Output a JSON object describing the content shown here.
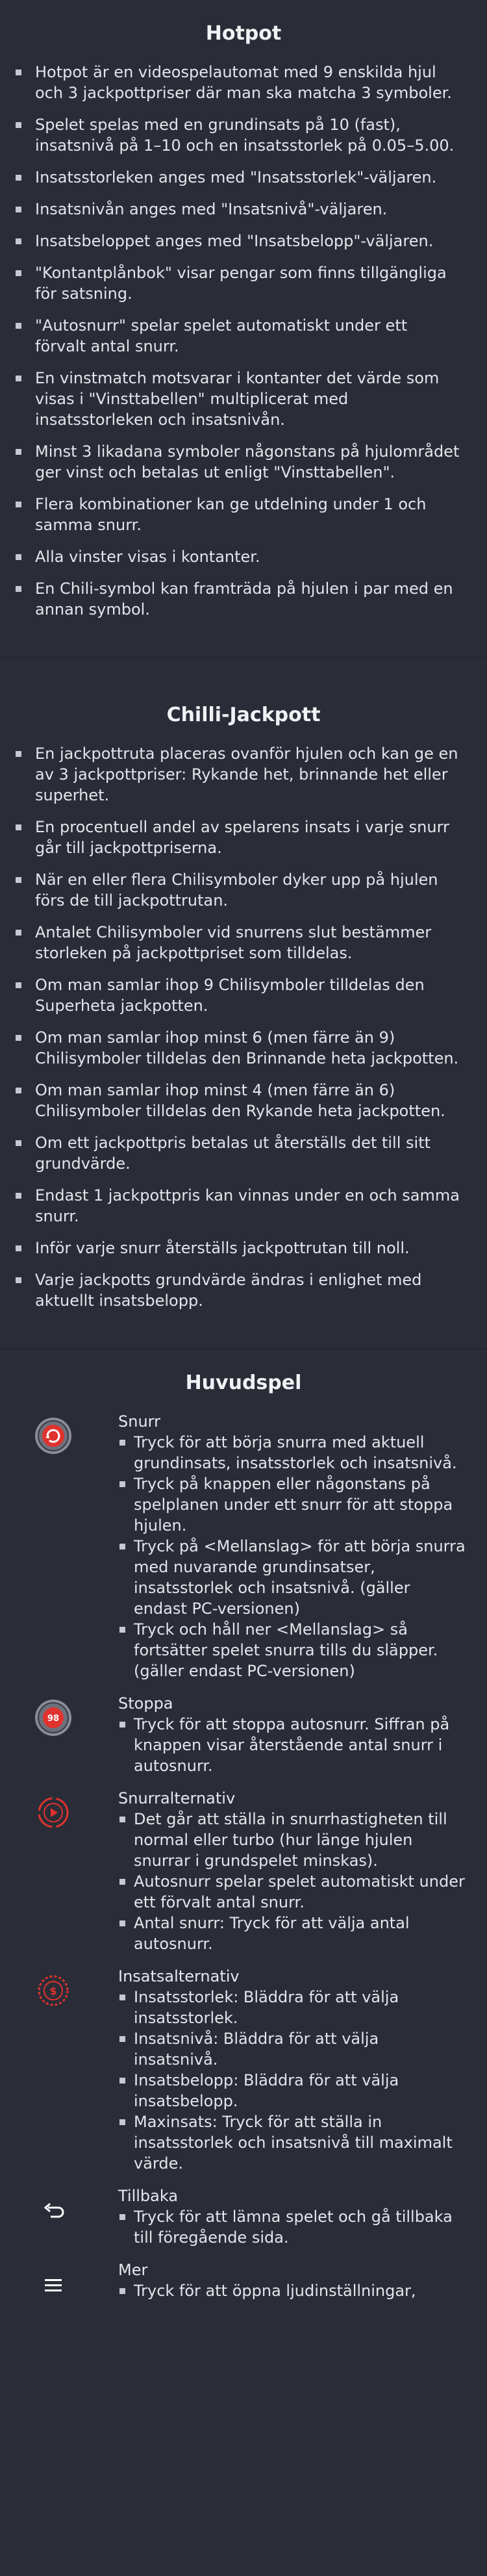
{
  "hotpot": {
    "title": "Hotpot",
    "items": [
      "Hotpot är en videospelautomat med 9 enskilda hjul och 3 jackpottpriser där man ska matcha 3 symboler.",
      "Spelet spelas med en grundinsats på 10 (fast), insatsnivå på 1–10 och en insatsstorlek på 0.05–5.00.",
      "Insatsstorleken anges med \"Insatsstorlek\"-väljaren.",
      "Insatsnivån anges med \"Insatsnivå\"-väljaren.",
      "Insatsbeloppet anges med \"Insatsbelopp\"-väljaren.",
      "\"Kontantplånbok\" visar pengar som finns tillgängliga för satsning.",
      "\"Autosnurr\" spelar spelet automatiskt under ett förvalt antal snurr.",
      "En vinstmatch motsvarar i kontanter det värde som visas i \"Vinsttabellen\" multiplicerat med insatsstorleken och insatsnivån.",
      "Minst 3  likadana symboler någonstans på hjulområdet ger vinst och betalas ut enligt \"Vinsttabellen\".",
      "Flera kombinationer kan ge utdelning under 1 och samma snurr.",
      "Alla vinster visas i kontanter.",
      "En Chili-symbol kan framträda på hjulen i par med en annan symbol."
    ]
  },
  "chilli": {
    "title": "Chilli-Jackpott",
    "items": [
      "En jackpottruta placeras ovanför hjulen och kan ge en av 3 jackpottpriser: Rykande het, brinnande het eller superhet.",
      "En procentuell andel av spelarens insats i varje snurr går till jackpottpriserna.",
      "När en eller flera Chilisymboler dyker upp på hjulen förs de till jackpottrutan.",
      "Antalet Chilisymboler vid snurrens slut bestämmer storleken på jackpottpriset som tilldelas.",
      "Om man samlar ihop 9 Chilisymboler tilldelas den Superheta jackpotten.",
      "Om man samlar ihop minst 6 (men färre än 9) Chilisymboler tilldelas den Brinnande heta jackpotten.",
      "Om man samlar ihop minst 4 (men färre än 6) Chilisymboler tilldelas den Rykande heta jackpotten.",
      "Om ett jackpottpris betalas ut återställs det till sitt grundvärde.",
      "Endast 1 jackpottpris kan vinnas under en och samma snurr.",
      "Inför varje snurr återställs jackpottrutan till noll.",
      "Varje jackpotts grundvärde ändras i enlighet med aktuellt insatsbelopp."
    ]
  },
  "huvudspel": {
    "title": "Huvudspel",
    "rows": [
      {
        "title": "Snurr",
        "items": [
          "Tryck för att börja snurra med aktuell grundinsats, insatsstorlek och insatsnivå.",
          "Tryck på knappen eller någonstans på spelplanen under ett snurr för att stoppa hjulen.",
          "Tryck på <Mellanslag> för att börja snurra med nuvarande grundinsatser, insatsstorlek och insatsnivå. (gäller endast PC-versionen)",
          "Tryck och håll ner <Mellanslag> så fortsätter spelet snurra tills du släpper. (gäller endast PC-versionen)"
        ]
      },
      {
        "title": "Stoppa",
        "badge": "98",
        "items": [
          "Tryck för att stoppa autosnurr. Siffran på knappen visar återstående antal snurr i autosnurr."
        ]
      },
      {
        "title": "Snurralternativ",
        "items": [
          "Det går att ställa in snurrhastigheten till normal eller turbo (hur länge hjulen snurrar i grundspelet minskas).",
          "Autosnurr spelar spelet automatiskt under ett förvalt antal snurr.",
          "Antal snurr: Tryck för att välja antal autosnurr."
        ]
      },
      {
        "title": "Insatsalternativ",
        "items": [
          "Insatsstorlek: Bläddra för att välja insatsstorlek.",
          "Insatsnivå: Bläddra för att välja insatsnivå.",
          "Insatsbelopp: Bläddra för att välja insatsbelopp.",
          "Maxinsats: Tryck för att ställa in insatsstorlek och insatsnivå till maximalt värde."
        ]
      },
      {
        "title": "Tillbaka",
        "items": [
          "Tryck för att lämna spelet och gå tillbaka till föregående sida."
        ]
      },
      {
        "title": "Mer",
        "items": [
          "Tryck för att öppna ljudinställningar,"
        ]
      }
    ]
  },
  "colors": {
    "background": "#2a2d37",
    "text": "#e3e5ea",
    "accent_red": "#e0322e",
    "button_gray": "#8a8d97"
  },
  "icons": [
    "spin-button-icon",
    "stop-autospin-icon",
    "spin-options-icon",
    "bet-options-icon",
    "back-arrow-icon",
    "menu-icon"
  ]
}
